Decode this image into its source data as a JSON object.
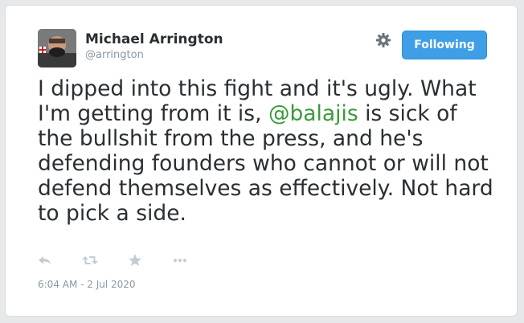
{
  "user": {
    "name": "Michael Arrington",
    "handle": "@arrington"
  },
  "follow_button": {
    "label": "Following",
    "color": "#3f9fe6"
  },
  "tweet": {
    "text_before": "I dipped into this fight and it's ugly. What I'm getting from it is, ",
    "mention": "@balajis",
    "text_after": " is sick of the bullshit from the press, and he's defending founders who cannot or will not defend themselves as effectively. Not hard to pick a side.",
    "mention_color": "#3a9a3a"
  },
  "actions": [
    {
      "icon": "reply-icon"
    },
    {
      "icon": "retweet-icon"
    },
    {
      "icon": "favorite-star-icon"
    },
    {
      "icon": "more-options-icon"
    }
  ],
  "timestamp": "6:04 AM - 2 Jul 2020"
}
